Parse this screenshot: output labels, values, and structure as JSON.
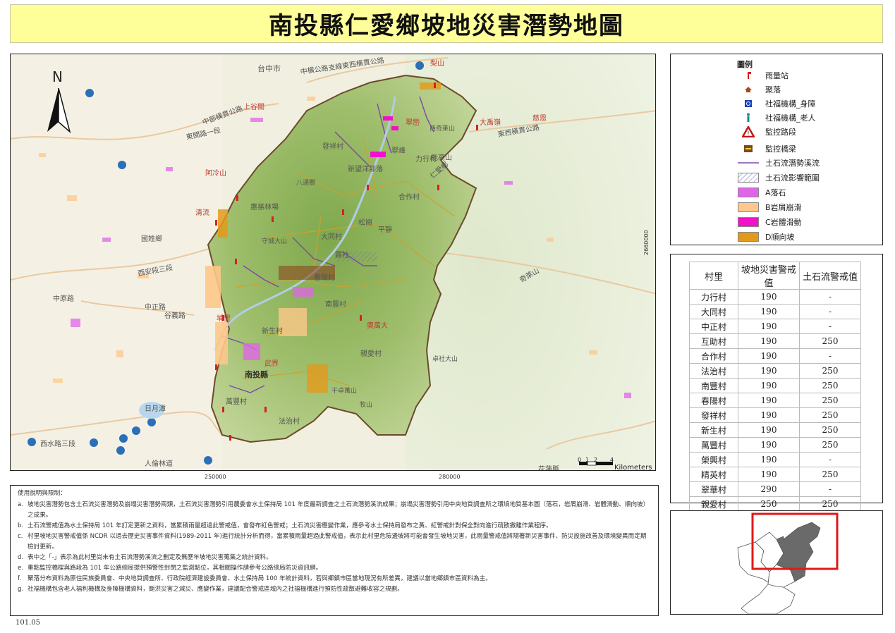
{
  "title": "南投縣仁愛鄉坡地災害潛勢地圖",
  "map": {
    "north_label": "N",
    "scale_ticks": [
      "0",
      "1",
      "2",
      "4"
    ],
    "scale_unit": "Kilometers",
    "x_coords": [
      "250000",
      "280000"
    ],
    "y_coord": "2660000",
    "labels": [
      {
        "text": "台中市",
        "color": "#555"
      },
      {
        "text": "中橫公路支線東西橫貫公路",
        "color": "#555"
      },
      {
        "text": "梨山",
        "color": "#c0392b"
      },
      {
        "text": "上谷關",
        "color": "#c0392b"
      },
      {
        "text": "大禹嶺",
        "color": "#c0392b"
      },
      {
        "text": "慈恩",
        "color": "#c0392b"
      },
      {
        "text": "東西橫貫公路",
        "color": "#555"
      },
      {
        "text": "東關路一段",
        "color": "#555"
      },
      {
        "text": "中部橫貫公路",
        "color": "#555"
      },
      {
        "text": "翠巒",
        "color": "#c0392b"
      },
      {
        "text": "西奇萊山",
        "color": "#555"
      },
      {
        "text": "翠峰",
        "color": "#555"
      },
      {
        "text": "發祥村",
        "color": "#555"
      },
      {
        "text": "新望洋部落",
        "color": "#555"
      },
      {
        "text": "阿冷山",
        "color": "#c0392b"
      },
      {
        "text": "八通關",
        "color": "#555"
      },
      {
        "text": "能高山",
        "color": "#555"
      },
      {
        "text": "力行村",
        "color": "#555"
      },
      {
        "text": "合作村",
        "color": "#555"
      },
      {
        "text": "惠蓀林場",
        "color": "#555"
      },
      {
        "text": "仁愛鄉",
        "color": "#555"
      },
      {
        "text": "清流",
        "color": "#c0392b"
      },
      {
        "text": "國姓鄉",
        "color": "#555"
      },
      {
        "text": "西安段三段",
        "color": "#555"
      },
      {
        "text": "守城大山",
        "color": "#555"
      },
      {
        "text": "大同村",
        "color": "#555"
      },
      {
        "text": "松崗",
        "color": "#555"
      },
      {
        "text": "平靜",
        "color": "#555"
      },
      {
        "text": "霧社",
        "color": "#555"
      },
      {
        "text": "春陽村",
        "color": "#555"
      },
      {
        "text": "中原路",
        "color": "#555"
      },
      {
        "text": "奇萊山",
        "color": "#555"
      },
      {
        "text": "南豐村",
        "color": "#555"
      },
      {
        "text": "中正路",
        "color": "#555"
      },
      {
        "text": "谷義路",
        "color": "#555"
      },
      {
        "text": "奧萬大",
        "color": "#c0392b"
      },
      {
        "text": "埔里",
        "color": "#c0392b"
      },
      {
        "text": "新生村",
        "color": "#555"
      },
      {
        "text": "南投縣",
        "color": "#333"
      },
      {
        "text": "親愛村",
        "color": "#555"
      },
      {
        "text": "卓社大山",
        "color": "#555"
      },
      {
        "text": "干卓萬山",
        "color": "#555"
      },
      {
        "text": "牧山",
        "color": "#555"
      },
      {
        "text": "法治村",
        "color": "#555"
      },
      {
        "text": "武界",
        "color": "#c0392b"
      },
      {
        "text": "萬豐村",
        "color": "#555"
      },
      {
        "text": "人倫林道",
        "color": "#555"
      },
      {
        "text": "花蓮縣",
        "color": "#555"
      },
      {
        "text": "日月潭",
        "color": "#555"
      },
      {
        "text": "西水路三段",
        "color": "#555"
      }
    ]
  },
  "legend": {
    "title": "圖例",
    "items": [
      {
        "label": "雨量站",
        "symbol": "rain-gauge"
      },
      {
        "label": "聚落",
        "symbol": "settlement"
      },
      {
        "label": "社福機構_身障",
        "symbol": "disability-facility"
      },
      {
        "label": "社福機構_老人",
        "symbol": "elderly-facility"
      },
      {
        "label": "監控路段",
        "symbol": "warning-triangle"
      },
      {
        "label": "監控橋梁",
        "symbol": "bridge"
      },
      {
        "label": "土石流潛勢溪流",
        "symbol": "stream-line"
      },
      {
        "label": "土石流影響範圍",
        "symbol": "hatched-area"
      },
      {
        "label": "A落石",
        "symbol": "swatch",
        "color": "#e066e8"
      },
      {
        "label": "B岩屑崩滑",
        "symbol": "swatch",
        "color": "#fdc88a"
      },
      {
        "label": "C岩體滑動",
        "symbol": "swatch",
        "color": "#f011c8"
      },
      {
        "label": "D順向坡",
        "symbol": "swatch",
        "color": "#e39a1c"
      }
    ]
  },
  "table": {
    "headers": [
      "村里",
      "坡地災害警戒值",
      "土石流警戒值"
    ],
    "rows": [
      [
        "力行村",
        "190",
        "-"
      ],
      [
        "大同村",
        "190",
        "-"
      ],
      [
        "中正村",
        "190",
        "-"
      ],
      [
        "互助村",
        "190",
        "250"
      ],
      [
        "合作村",
        "190",
        "-"
      ],
      [
        "法治村",
        "190",
        "250"
      ],
      [
        "南豐村",
        "190",
        "250"
      ],
      [
        "春陽村",
        "190",
        "250"
      ],
      [
        "發祥村",
        "190",
        "250"
      ],
      [
        "新生村",
        "190",
        "250"
      ],
      [
        "萬豐村",
        "190",
        "250"
      ],
      [
        "榮興村",
        "190",
        "-"
      ],
      [
        "精英村",
        "190",
        "250"
      ],
      [
        "翠華村",
        "290",
        "-"
      ],
      [
        "親愛村",
        "250",
        "250"
      ]
    ]
  },
  "notes": {
    "heading": "使用說明與限制：",
    "items": [
      {
        "letter": "a.",
        "text": "坡地災害潛勢包含土石流災害潛勢及崩塌災害潛勢兩類，土石流災害潛勢引用農委會水土保持局 101 年度最新調查之土石流潛勢溪流成果；崩塌災害潛勢引用中央地質調查所之環境地質基本圖（落石，岩屑崩滑、岩體滑動、順向坡）之成果。"
      },
      {
        "letter": "b.",
        "text": "土石流警戒值為水土保持局 101 年訂定更新之資料，當累積雨量超過此警戒值，會發布紅色警戒；土石流災害應變作業，應參考水土保持局發布之黃、紅警戒針對保全對向進行疏散撤離作業程序。"
      },
      {
        "letter": "c.",
        "text": "村里坡地災害警戒值係 NCDR 以過去歷史災害事件資料(1989-2011 年)進行統計分析而得，當累積雨量超過此警戒值，表示此村里危險邊坡將可能會發生坡地災害，此雨量警戒值將隨著新災害事件、防災設施改善及環境變異而定期檢討更新。"
      },
      {
        "letter": "d.",
        "text": "表中之「-」表示為此村里尚未有土石流潛勢溪流之劃定及無歷年坡地災害蒐集之統計資料。"
      },
      {
        "letter": "e.",
        "text": "重點監控橋樑與路段為 101 年公路總局提供預警性封閉之監測點位，其相關操作請參考公路總局防災資訊網。"
      },
      {
        "letter": "f.",
        "text": "聚落分布資料為原住民族委員會、中央地質調查所、行政院經濟建設委員會、水土保持局 100 年統計資料，若與鄉鎮市區當地現況有所差異，建議以當地鄉鎮市區資料為主。"
      },
      {
        "letter": "g.",
        "text": "社福機構包含老人福利機構及身障機構資料，颱洪災害之減災、應變作業，建議配合警戒區域內之社福機構進行預防性疏散避難收容之規劃。"
      }
    ]
  },
  "version": "101.05"
}
